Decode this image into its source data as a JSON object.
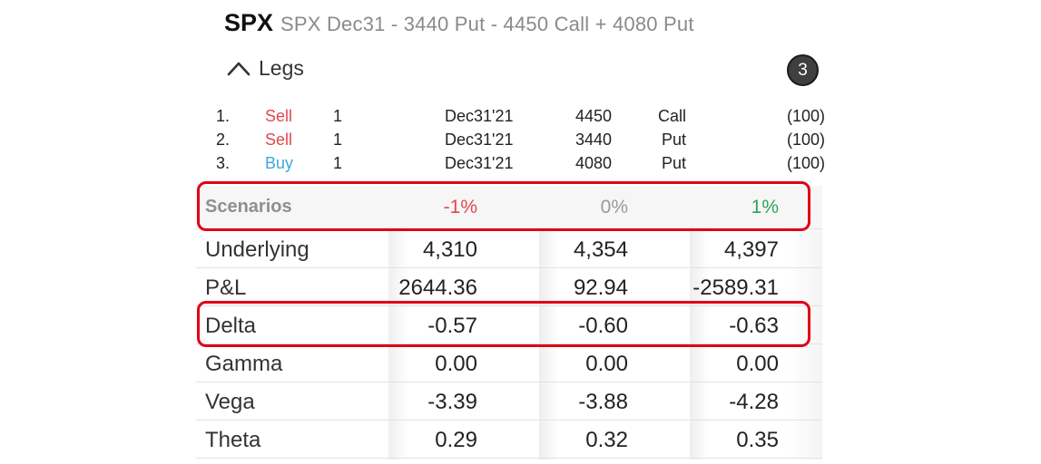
{
  "header": {
    "symbol": "SPX",
    "description": "SPX Dec31  - 3440 Put  - 4450 Call  + 4080 Put"
  },
  "legs_section": {
    "label": "Legs",
    "count": "3"
  },
  "legs": [
    {
      "num": "1.",
      "side": "Sell",
      "qty": "1",
      "expiry": "Dec31'21",
      "strike": "4450",
      "type": "Call",
      "multiplier": "(100)"
    },
    {
      "num": "2.",
      "side": "Sell",
      "qty": "1",
      "expiry": "Dec31'21",
      "strike": "3440",
      "type": "Put",
      "multiplier": "(100)"
    },
    {
      "num": "3.",
      "side": "Buy",
      "qty": "1",
      "expiry": "Dec31'21",
      "strike": "4080",
      "type": "Put",
      "multiplier": "(100)"
    }
  ],
  "scenarios": {
    "header_label": "Scenarios",
    "columns": [
      "-1%",
      "0%",
      "1%"
    ],
    "rows": [
      {
        "label": "Underlying",
        "values": [
          "4,310",
          "4,354",
          "4,397"
        ]
      },
      {
        "label": "P&L",
        "values": [
          "2644.36",
          "92.94",
          "-2589.31"
        ]
      },
      {
        "label": "Delta",
        "values": [
          "-0.57",
          "-0.60",
          "-0.63"
        ]
      },
      {
        "label": "Gamma",
        "values": [
          "0.00",
          "0.00",
          "0.00"
        ]
      },
      {
        "label": "Vega",
        "values": [
          "-3.39",
          "-3.88",
          "-4.28"
        ]
      },
      {
        "label": "Theta",
        "values": [
          "0.29",
          "0.32",
          "0.35"
        ]
      }
    ]
  },
  "colors": {
    "sell": "#e0484c",
    "buy": "#3ea6de",
    "negative_scenario": "#e0484c",
    "neutral_scenario": "#9a9a9a",
    "positive_scenario": "#2ea35a",
    "highlight": "#e00012"
  },
  "icons": {
    "collapse": "chevron-up-icon"
  }
}
